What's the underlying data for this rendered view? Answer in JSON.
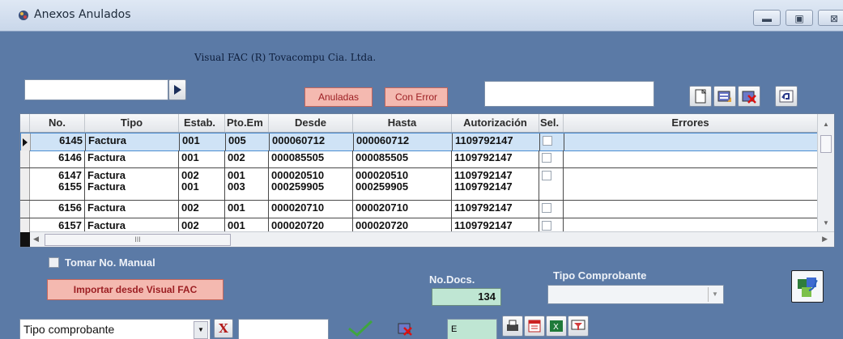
{
  "window": {
    "title": "Anexos Anulados",
    "company": "Visual FAC (R) Tovacompu  Cia. Ltda."
  },
  "toolbar": {
    "anuladas_label": "Anuladas",
    "con_error_label": "Con Error"
  },
  "grid": {
    "columns": [
      "No.",
      "Tipo",
      "Estab.",
      "Pto.Em",
      "Desde",
      "Hasta",
      "Autorización",
      "Sel.",
      "Errores"
    ],
    "rows": [
      {
        "no": "6145",
        "tipo": "Factura",
        "estab": "001",
        "pto": "005",
        "desde": "000060712",
        "hasta": "000060712",
        "aut": "1109792147"
      },
      {
        "no": "6146",
        "tipo": "Factura",
        "estab": "001",
        "pto": "002",
        "desde": "000085505",
        "hasta": "000085505",
        "aut": "1109792147"
      },
      {
        "no": "6147\n6155",
        "tipo": "Factura\nFactura",
        "estab": "002\n001",
        "pto": "001\n003",
        "desde": "000020510\n000259905",
        "hasta": "000020510\n000259905",
        "aut": "1109792147\n1109792147"
      },
      {
        "no": "6156",
        "tipo": "Factura",
        "estab": "002",
        "pto": "001",
        "desde": "000020710",
        "hasta": "000020710",
        "aut": "1109792147"
      },
      {
        "no": "6157",
        "tipo": "Factura",
        "estab": "002",
        "pto": "001",
        "desde": "000020720",
        "hasta": "000020720",
        "aut": "1109792147"
      }
    ],
    "scroll_glyph": "III"
  },
  "controls": {
    "tomar_manual_label": "Tomar No. Manual",
    "importar_label": "Importar desde Visual FAC",
    "nodocs_label": "No.Docs.",
    "nodocs_value": "134",
    "tipo_comp_label": "Tipo Comprobante"
  },
  "filter": {
    "tipo_select": "Tipo comprobante",
    "clear_label": "X",
    "e_value": "E"
  },
  "colors": {
    "background": "#5b7aa6",
    "selected_row": "#cfe3f6",
    "pink_button": "#f4b9b0",
    "nodocs_bg": "#bfe6d3"
  }
}
